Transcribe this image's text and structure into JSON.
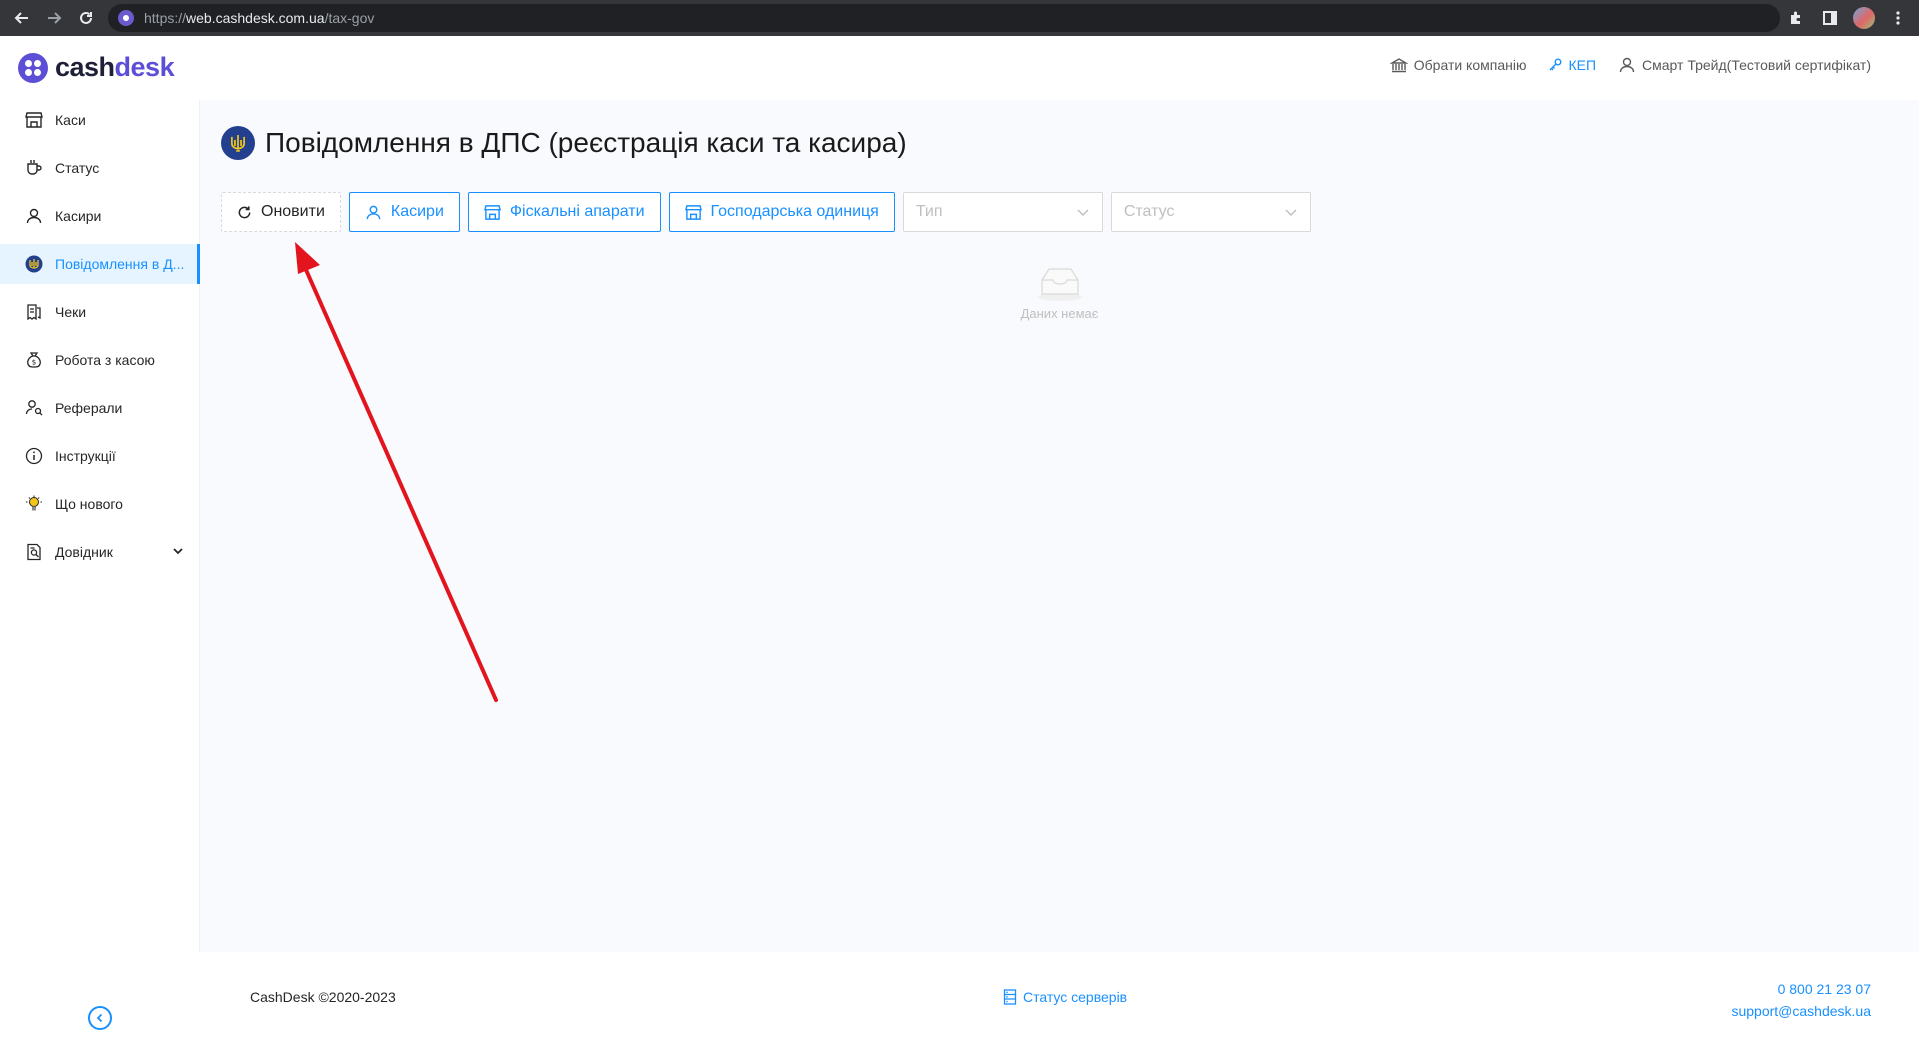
{
  "browser": {
    "url_scheme": "https://",
    "url_host": "web.cashdesk.com.ua",
    "url_path": "/tax-gov"
  },
  "brand": {
    "name_part1": "cash",
    "name_part2": "desk",
    "accent_color": "#5c4ed6"
  },
  "header": {
    "choose_company": "Обрати компанію",
    "kep": "КЕП",
    "user": "Смарт Трейд(Тестовий сертифікат)"
  },
  "sidebar": {
    "items": [
      {
        "label": "Каси",
        "icon": "store-icon"
      },
      {
        "label": "Статус",
        "icon": "coffee-cup-icon"
      },
      {
        "label": "Касири",
        "icon": "user-icon"
      },
      {
        "label": "Повідомлення в Д...",
        "icon": "trident-icon",
        "active": true
      },
      {
        "label": "Чеки",
        "icon": "receipts-icon"
      },
      {
        "label": "Робота з касою",
        "icon": "money-bag-icon"
      },
      {
        "label": "Реферали",
        "icon": "referrals-icon"
      },
      {
        "label": "Інструкції",
        "icon": "info-icon"
      },
      {
        "label": "Що нового",
        "icon": "lightbulb-icon"
      },
      {
        "label": "Довідник",
        "icon": "reference-book-icon"
      }
    ]
  },
  "page": {
    "title": "Повідомлення в ДПС (реєстрація каси та касира)"
  },
  "toolbar": {
    "refresh": "Оновити",
    "cashiers": "Касири",
    "fiscal_devices": "Фіскальні апарати",
    "business_unit": "Господарська одиниця",
    "type_placeholder": "Тип",
    "status_placeholder": "Статус"
  },
  "empty": {
    "text": "Даних немає"
  },
  "footer": {
    "copyright": "CashDesk ©2020-2023",
    "server_status": "Статус серверів",
    "phone": "0 800 21 23 07",
    "email": "support@cashdesk.ua"
  },
  "colors": {
    "primary": "#1890ff",
    "annotation_arrow": "#e3141e"
  }
}
